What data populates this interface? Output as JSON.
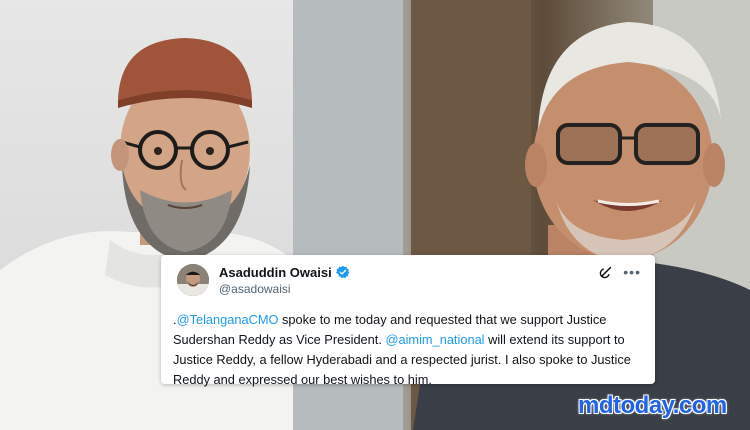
{
  "photos": {
    "left": {
      "subject": "man-in-skullcap-and-glasses"
    },
    "right": {
      "subject": "elderly-man-smiling-with-glasses"
    }
  },
  "tweet": {
    "author_name": "Asaduddin Owaisi",
    "author_handle": "@asadowaisi",
    "verified_icon": "verified-badge-icon",
    "more_icon": "more-icon",
    "grok_icon": "grok-icon",
    "text_parts": {
      "p1": ".",
      "mention1": "@TelanganaCMO",
      "p2": " spoke to me today and requested that we support Justice Sudershan Reddy as Vice President. ",
      "mention2": "@aimim_national",
      "p3": " will extend its support to Justice Reddy, a fellow Hyderabadi and a respected jurist. I also spoke to Justice Reddy and expressed our best wishes to him."
    }
  },
  "watermark": {
    "text": "mdtoday.com"
  },
  "colors": {
    "mention": "#1d9bf0",
    "verified": "#1d9bf0",
    "watermark": "#1f63e6"
  }
}
